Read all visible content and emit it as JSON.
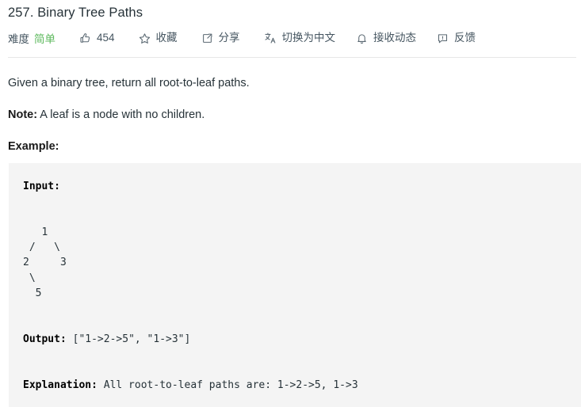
{
  "problem": {
    "title": "257. Binary Tree Paths"
  },
  "toolbar": {
    "difficulty_label": "难度",
    "difficulty_value": "简单",
    "difficulty_color": "#5cb85c",
    "like_icon": "thumbs-up-icon",
    "like_count": "454",
    "favorite_icon": "star-icon",
    "favorite_label": "收藏",
    "share_icon": "share-icon",
    "share_label": "分享",
    "translate_icon": "translate-icon",
    "translate_label": "切换为中文",
    "subscribe_icon": "bell-icon",
    "subscribe_label": "接收动态",
    "feedback_icon": "feedback-bubble-icon",
    "feedback_label": "反馈"
  },
  "description": {
    "statement": "Given a binary tree, return all root-to-leaf paths.",
    "note_label": "Note:",
    "note_text": " A leaf is a node with no children.",
    "example_label": "Example:"
  },
  "example": {
    "input_label": "Input:",
    "tree_lines": [
      "   1",
      " /   \\",
      "2     3",
      " \\",
      "  5"
    ],
    "output_label": "Output:",
    "output_value": " [\"1->2->5\", \"1->3\"]",
    "explanation_label": "Explanation:",
    "explanation_value": " All root-to-leaf paths are: 1->2->5, 1->3"
  },
  "colors": {
    "code_background": "#f4f4f4",
    "text": "#263238",
    "divider": "#e7e7e7"
  }
}
